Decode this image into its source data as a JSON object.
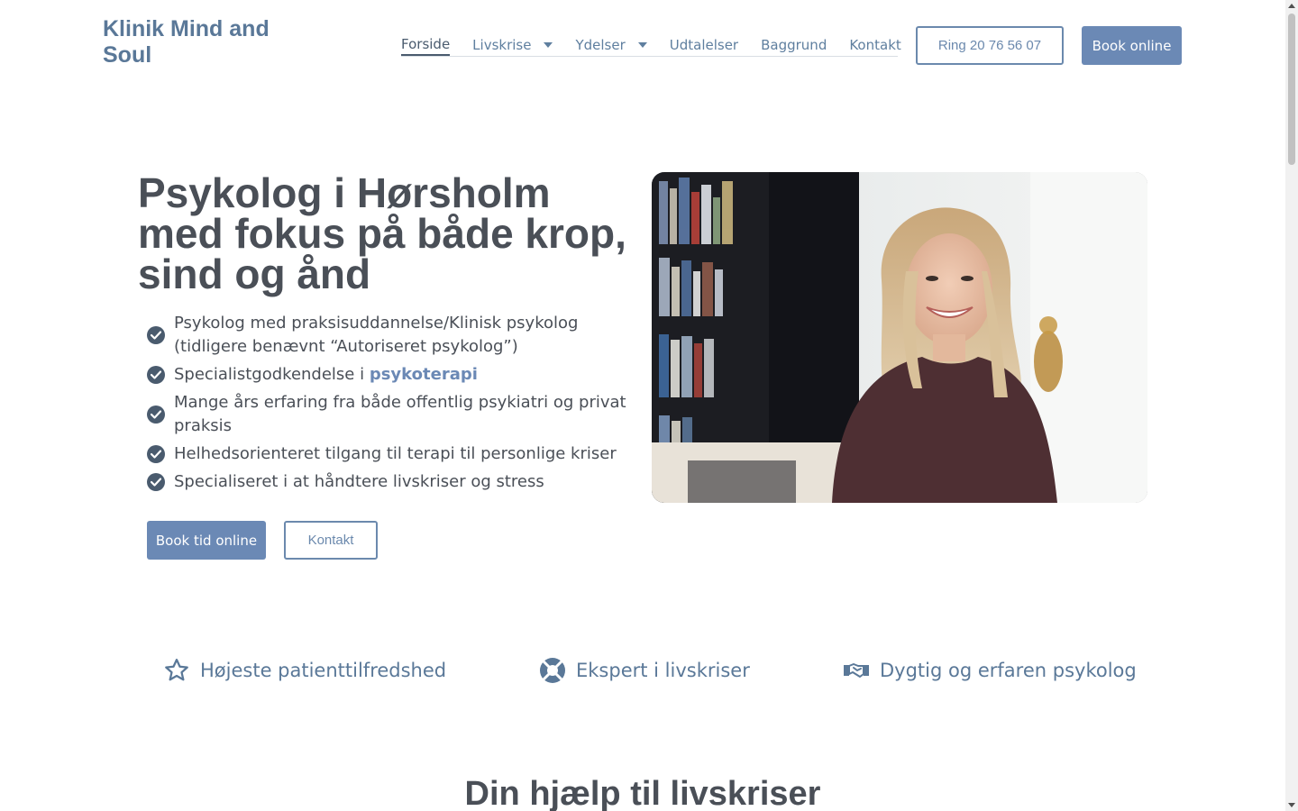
{
  "header": {
    "logo": "Klinik Mind and Soul",
    "nav": [
      {
        "label": "Forside",
        "active": true,
        "dropdown": false
      },
      {
        "label": "Livskrise",
        "active": false,
        "dropdown": true
      },
      {
        "label": "Ydelser",
        "active": false,
        "dropdown": true
      },
      {
        "label": "Udtalelser",
        "active": false,
        "dropdown": false
      },
      {
        "label": "Baggrund",
        "active": false,
        "dropdown": false
      },
      {
        "label": "Kontakt",
        "active": false,
        "dropdown": false
      }
    ],
    "call_button": "Ring 20 76 56 07",
    "book_button": "Book online"
  },
  "hero": {
    "title": "Psykolog i Hørsholm med fokus på både krop, sind og ånd",
    "checklist": [
      {
        "text": "Psykolog med praksisuddannelse/Klinisk psykolog (tidligere benævnt “Autoriseret psykolog”)"
      },
      {
        "text": "Specialistgodkendelse i ",
        "link": "psykoterapi"
      },
      {
        "text": "Mange års erfaring fra både offentlig psykiatri og privat praksis"
      },
      {
        "text": "Helhedsorienteret tilgang til terapi til personlige kriser"
      },
      {
        "text": "Specialiseret i at håndtere livskriser og stress"
      }
    ],
    "book_button": "Book tid online",
    "contact_button": "Kontakt"
  },
  "features": [
    {
      "icon": "star-icon",
      "label": "Højeste patienttilfredshed"
    },
    {
      "icon": "life-ring-icon",
      "label": "Ekspert i livskriser"
    },
    {
      "icon": "handshake-icon",
      "label": "Dygtig og erfaren psykolog"
    }
  ],
  "section": {
    "title": "Din hjælp til livskriser"
  },
  "colors": {
    "accent": "#6b89b5",
    "heading": "#4a4f57",
    "logo": "#5a7898"
  }
}
